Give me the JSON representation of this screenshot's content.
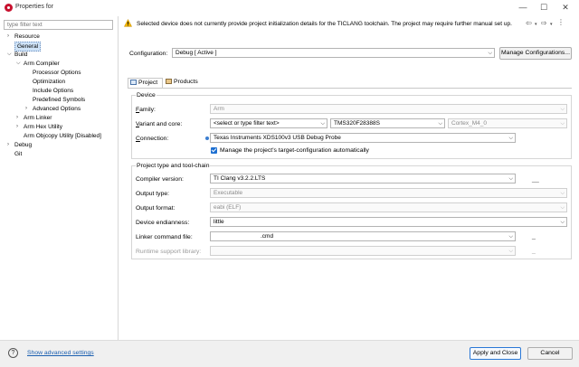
{
  "window": {
    "title": "Properties for",
    "controls": {
      "minimize": "—",
      "maximize": "☐",
      "close": "✕"
    }
  },
  "sidebar": {
    "filter_placeholder": "type filter text",
    "items": [
      {
        "label": "Resource",
        "level": 0,
        "expandable": true,
        "expanded": false
      },
      {
        "label": "General",
        "level": 0,
        "selected": true
      },
      {
        "label": "Build",
        "level": 0,
        "expandable": true,
        "expanded": true
      },
      {
        "label": "Arm Compiler",
        "level": 1,
        "expandable": true,
        "expanded": true
      },
      {
        "label": "Processor Options",
        "level": 2
      },
      {
        "label": "Optimization",
        "level": 2
      },
      {
        "label": "Include Options",
        "level": 2
      },
      {
        "label": "Predefined Symbols",
        "level": 2
      },
      {
        "label": "Advanced Options",
        "level": 2,
        "expandable": true,
        "expanded": false
      },
      {
        "label": "Arm Linker",
        "level": 1,
        "expandable": true,
        "expanded": false
      },
      {
        "label": "Arm Hex Utility",
        "level": 1,
        "expandable": true,
        "expanded": false
      },
      {
        "label": "Arm Objcopy Utility  [Disabled]",
        "level": 1
      },
      {
        "label": "Debug",
        "level": 0,
        "expandable": true,
        "expanded": false
      },
      {
        "label": "Git",
        "level": 0
      }
    ]
  },
  "warning": {
    "text": "Selected device does not currently provide project initialization details for the TICLANG toolchain. The project may require further manual set up."
  },
  "configuration": {
    "label": "Configuration:",
    "value": "Debug  [ Active ]",
    "manage_button": "Manage Configurations..."
  },
  "tabs": [
    {
      "label": "Project",
      "active": true,
      "icon": "project-icon"
    },
    {
      "label": "Products",
      "active": false,
      "icon": "products-icon"
    }
  ],
  "device": {
    "group_title": "Device",
    "family_label": "Family:",
    "family_value": "Arm",
    "variant_label": "Variant and core:",
    "variant_filter": "<select or type filter text>",
    "variant_value": "TMS320F28388S",
    "core_value": "Cortex_M4_0",
    "connection_label": "Connection:",
    "connection_value": "Texas Instruments XDS100v3 USB Debug Probe",
    "manage_target_label": "Manage the project's target-configuration automatically",
    "manage_target_checked": true
  },
  "project_type": {
    "group_title": "Project type and tool-chain",
    "compiler_label": "Compiler version:",
    "compiler_value": "TI Clang v3.2.2.LTS",
    "output_type_label": "Output type:",
    "output_type_value": "Executable",
    "output_format_label": "Output format:",
    "output_format_value": "eabi (ELF)",
    "endianness_label": "Device endianness:",
    "endianness_value": "little",
    "linker_label": "Linker command file:",
    "linker_value": ".cmd",
    "runtime_label": "Runtime support library:",
    "runtime_value": ""
  },
  "footer": {
    "help_icon": "?",
    "advanced_link": "Show advanced settings",
    "apply_close": "Apply and Close",
    "cancel": "Cancel"
  },
  "colors": {
    "accent": "#1d6fd1",
    "selection": "#cfe3f7",
    "warning": "#f0b400",
    "link": "#1b5fb0"
  }
}
